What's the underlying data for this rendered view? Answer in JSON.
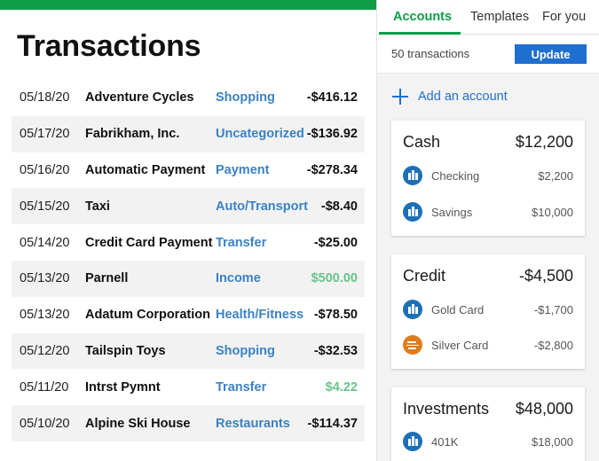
{
  "page": {
    "title": "Transactions"
  },
  "transactions": [
    {
      "date": "05/18/20",
      "payee": "Adventure Cycles",
      "category": "Shopping",
      "amount": "-$416.12",
      "positive": false
    },
    {
      "date": "05/17/20",
      "payee": "Fabrikham, Inc.",
      "category": "Uncategorized",
      "amount": "-$136.92",
      "positive": false
    },
    {
      "date": "05/16/20",
      "payee": "Automatic Payment",
      "category": "Payment",
      "amount": "-$278.34",
      "positive": false
    },
    {
      "date": "05/15/20",
      "payee": "Taxi",
      "category": "Auto/Transport",
      "amount": "-$8.40",
      "positive": false
    },
    {
      "date": "05/14/20",
      "payee": "Credit Card Payment",
      "category": "Transfer",
      "amount": "-$25.00",
      "positive": false
    },
    {
      "date": "05/13/20",
      "payee": "Parnell",
      "category": "Income",
      "amount": "$500.00",
      "positive": true
    },
    {
      "date": "05/13/20",
      "payee": "Adatum Corporation",
      "category": "Health/Fitness",
      "amount": "-$78.50",
      "positive": false
    },
    {
      "date": "05/12/20",
      "payee": "Tailspin Toys",
      "category": "Shopping",
      "amount": "-$32.53",
      "positive": false
    },
    {
      "date": "05/11/20",
      "payee": "Intrst Pymnt",
      "category": "Transfer",
      "amount": "$4.22",
      "positive": true
    },
    {
      "date": "05/10/20",
      "payee": "Alpine Ski House",
      "category": "Restaurants",
      "amount": "-$114.37",
      "positive": false
    }
  ],
  "tabs": [
    {
      "label": "Accounts",
      "active": true
    },
    {
      "label": "Templates",
      "active": false
    },
    {
      "label": "For you",
      "active": false
    }
  ],
  "summary": {
    "count_text": "50 transactions",
    "update_label": "Update"
  },
  "add_account_label": "Add an account",
  "cards": [
    {
      "title": "Cash",
      "total": "$12,200",
      "accounts": [
        {
          "name": "Checking",
          "balance": "$2,200",
          "icon": "bank-icon"
        },
        {
          "name": "Savings",
          "balance": "$10,000",
          "icon": "bank-icon"
        }
      ]
    },
    {
      "title": "Credit",
      "total": "-$4,500",
      "accounts": [
        {
          "name": "Gold Card",
          "balance": "-$1,700",
          "icon": "bank-icon"
        },
        {
          "name": "Silver Card",
          "balance": "-$2,800",
          "icon": "wind-icon"
        }
      ]
    },
    {
      "title": "Investments",
      "total": "$48,000",
      "accounts": [
        {
          "name": "401K",
          "balance": "$18,000",
          "icon": "bank-icon"
        }
      ]
    }
  ],
  "colors": {
    "accent_green": "#0f9d48",
    "link_blue": "#1e6fd0",
    "category_blue": "#3b82c4",
    "positive_green": "#66c48a",
    "bank_icon": "#1e6fb8",
    "wind_icon": "#e07b1a"
  }
}
